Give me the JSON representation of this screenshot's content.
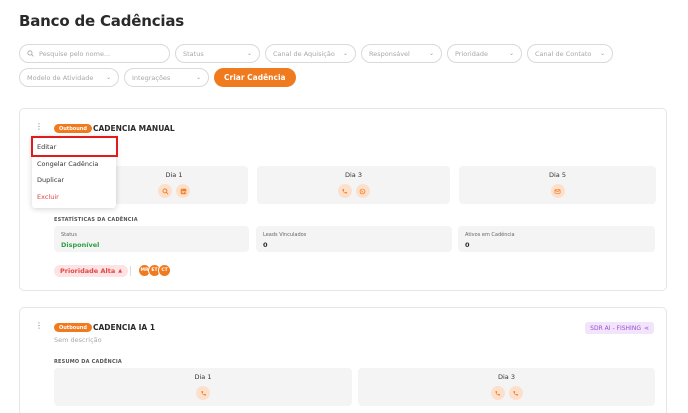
{
  "page": {
    "title": "Banco de Cadências"
  },
  "filters": {
    "search_placeholder": "Pesquise pelo nome...",
    "status": "Status",
    "canal_aquisicao": "Canal de Aquisição",
    "responsavel": "Responsável",
    "prioridade": "Prioridade",
    "canal_contato": "Canal de Contato",
    "modelo_atividade": "Modelo de Atividade",
    "integracoes": "Integrações",
    "create_button": "Criar Cadência"
  },
  "menu": {
    "items": [
      "Editar",
      "Congelar Cadência",
      "Duplicar",
      "Excluir"
    ]
  },
  "cadences": [
    {
      "badge": "Outbound",
      "title": "CADENCIA MANUAL",
      "days": [
        {
          "label": "Dia 1",
          "icons": [
            "search-icon",
            "linkedin-icon"
          ]
        },
        {
          "label": "Dia 3",
          "icons": [
            "phone-icon",
            "whatsapp-icon"
          ]
        },
        {
          "label": "Dia 5",
          "icons": [
            "email-icon"
          ]
        }
      ],
      "stats_label": "ESTATÍSTICAS DA CADÊNCIA",
      "stats": [
        {
          "label": "Status",
          "value": "Disponível"
        },
        {
          "label": "Leads Vinculados",
          "value": "0"
        },
        {
          "label": "Ativos em Cadência",
          "value": "0"
        }
      ],
      "priority": "Prioridade Alta",
      "avatars": [
        "MR",
        "ET",
        "CT"
      ],
      "colors": {
        "accent": "#f07a1e",
        "status_ok": "#2ea043",
        "priority": "#e04848"
      }
    },
    {
      "badge": "Outbound",
      "title": "CADENCIA IA 1",
      "description": "Sem descrição",
      "ai_badge": "SDR AI - FISHING",
      "summary_label": "RESUMO DA CADÊNCIA",
      "days": [
        {
          "label": "Dia 1",
          "icons": [
            "phone-icon"
          ]
        },
        {
          "label": "Dia 3",
          "icons": [
            "phone-icon",
            "phone-icon"
          ]
        }
      ]
    }
  ]
}
